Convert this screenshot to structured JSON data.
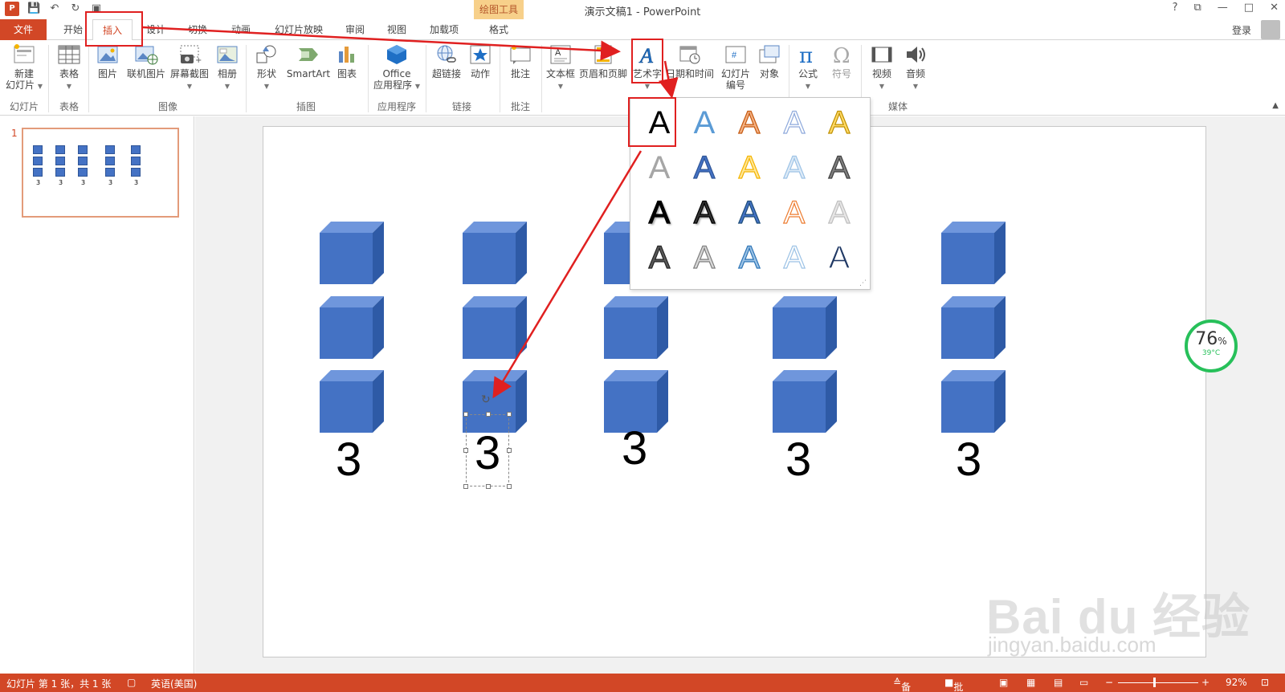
{
  "window": {
    "title": "演示文稿1 - PowerPoint",
    "context_tab": "绘图工具",
    "help": "?",
    "restore": "⧉",
    "minimize": "—",
    "maximize": "□",
    "close": "✕",
    "login": "登录"
  },
  "qat": {
    "app_logo": "P",
    "save_icon": "💾",
    "undo_icon": "↶",
    "redo_icon": "↻",
    "present_icon": "▣"
  },
  "tabs": [
    "文件",
    "开始",
    "插入",
    "设计",
    "切换",
    "动画",
    "幻灯片放映",
    "审阅",
    "视图",
    "加载项",
    "格式"
  ],
  "ribbon": {
    "buttons": [
      {
        "label": "新建",
        "label2": "幻灯片",
        "icon": "new-slide-icon"
      },
      {
        "label": "表格",
        "icon": "table-icon"
      },
      {
        "label": "图片",
        "icon": "picture-icon"
      },
      {
        "label": "联机图片",
        "icon": "online-picture-icon"
      },
      {
        "label": "屏幕截图",
        "icon": "screenshot-icon"
      },
      {
        "label": "相册",
        "icon": "album-icon"
      },
      {
        "label": "形状",
        "icon": "shapes-icon"
      },
      {
        "label": "SmartArt",
        "icon": "smartart-icon"
      },
      {
        "label": "图表",
        "icon": "chart-icon"
      },
      {
        "label": "Office",
        "label2": "应用程序",
        "icon": "office-apps-icon"
      },
      {
        "label": "超链接",
        "icon": "hyperlink-icon"
      },
      {
        "label": "动作",
        "icon": "action-icon"
      },
      {
        "label": "批注",
        "icon": "comment-icon"
      },
      {
        "label": "文本框",
        "icon": "textbox-icon"
      },
      {
        "label": "页眉和页脚",
        "icon": "header-footer-icon"
      },
      {
        "label": "艺术字",
        "icon": "wordart-icon"
      },
      {
        "label": "日期和时间",
        "icon": "datetime-icon"
      },
      {
        "label": "幻灯片",
        "label2": "编号",
        "icon": "slide-number-icon"
      },
      {
        "label": "对象",
        "icon": "object-icon"
      },
      {
        "label": "公式",
        "icon": "equation-icon"
      },
      {
        "label": "符号",
        "icon": "symbol-icon"
      },
      {
        "label": "视频",
        "icon": "video-icon"
      },
      {
        "label": "音频",
        "icon": "audio-icon"
      }
    ],
    "groups": [
      "幻灯片",
      "表格",
      "图像",
      "插图",
      "应用程序",
      "链接",
      "批注",
      "媒体"
    ]
  },
  "thumbnail": {
    "slide_number": "1",
    "numbers": [
      "3",
      "3",
      "3",
      "3",
      "3"
    ]
  },
  "slide": {
    "numbers": [
      "3",
      "3",
      "3",
      "3",
      "3"
    ],
    "cube_color": "#4472c4"
  },
  "wordart": {
    "glyph": "A",
    "styles": 20
  },
  "status": {
    "slide_info": "幻灯片 第 1 张，共 1 张",
    "language": "英语(美国)",
    "notes": "备注",
    "comments": "批注",
    "zoom": "92%"
  },
  "widget": {
    "percent": "76",
    "percent_sign": "%",
    "temperature": "39°C"
  },
  "watermark": {
    "brand": "Bai du 经验",
    "url": "jingyan.baidu.com"
  },
  "colors": {
    "accent": "#d24726",
    "annotation": "#e02020",
    "widget": "#27c05a"
  }
}
